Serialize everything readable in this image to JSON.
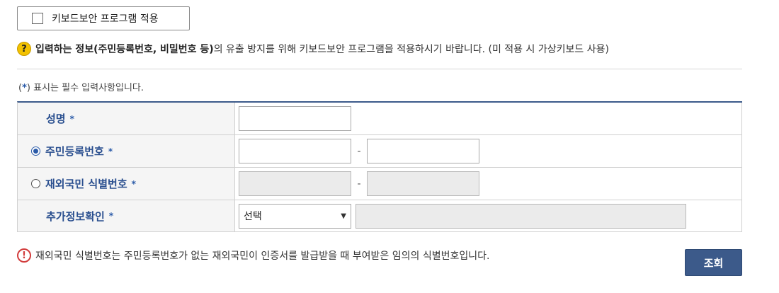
{
  "keyboard_security": {
    "label": "키보드보안 프로그램 적용",
    "checked": false
  },
  "notice": {
    "icon": "?",
    "bold_text": "입력하는 정보(주민등록번호, 비밀번호 등)",
    "rest_text": "의 유출 방지를 위해 키보드보안 프로그램을 적용하시기 바랍니다. (미 적용 시 가상키보드 사용)"
  },
  "required_note": {
    "open": "(",
    "star": "*",
    "close": ") 표시는 필수 입력사항입니다."
  },
  "form": {
    "name": {
      "label": "성명",
      "value": ""
    },
    "resident_number": {
      "label": "주민등록번호",
      "selected": true,
      "separator": "-"
    },
    "overseas_number": {
      "label": "재외국민 식별번호",
      "selected": false,
      "separator": "-"
    },
    "extra_info": {
      "label": "추가정보확인",
      "select_value": "선택"
    },
    "required_mark": "*"
  },
  "bottom_note": {
    "icon": "!",
    "text": "재외국민 식별번호는 주민등록번호가 없는 재외국민이 인증서를 발급받을 때 부여받은 임의의 식별번호입니다."
  },
  "search_button": {
    "label": "조회"
  },
  "colors": {
    "accent": "#3c5a8a",
    "label_blue": "#2a4f8f",
    "warning_red": "#d23c3c",
    "help_yellow": "#f3c200"
  }
}
